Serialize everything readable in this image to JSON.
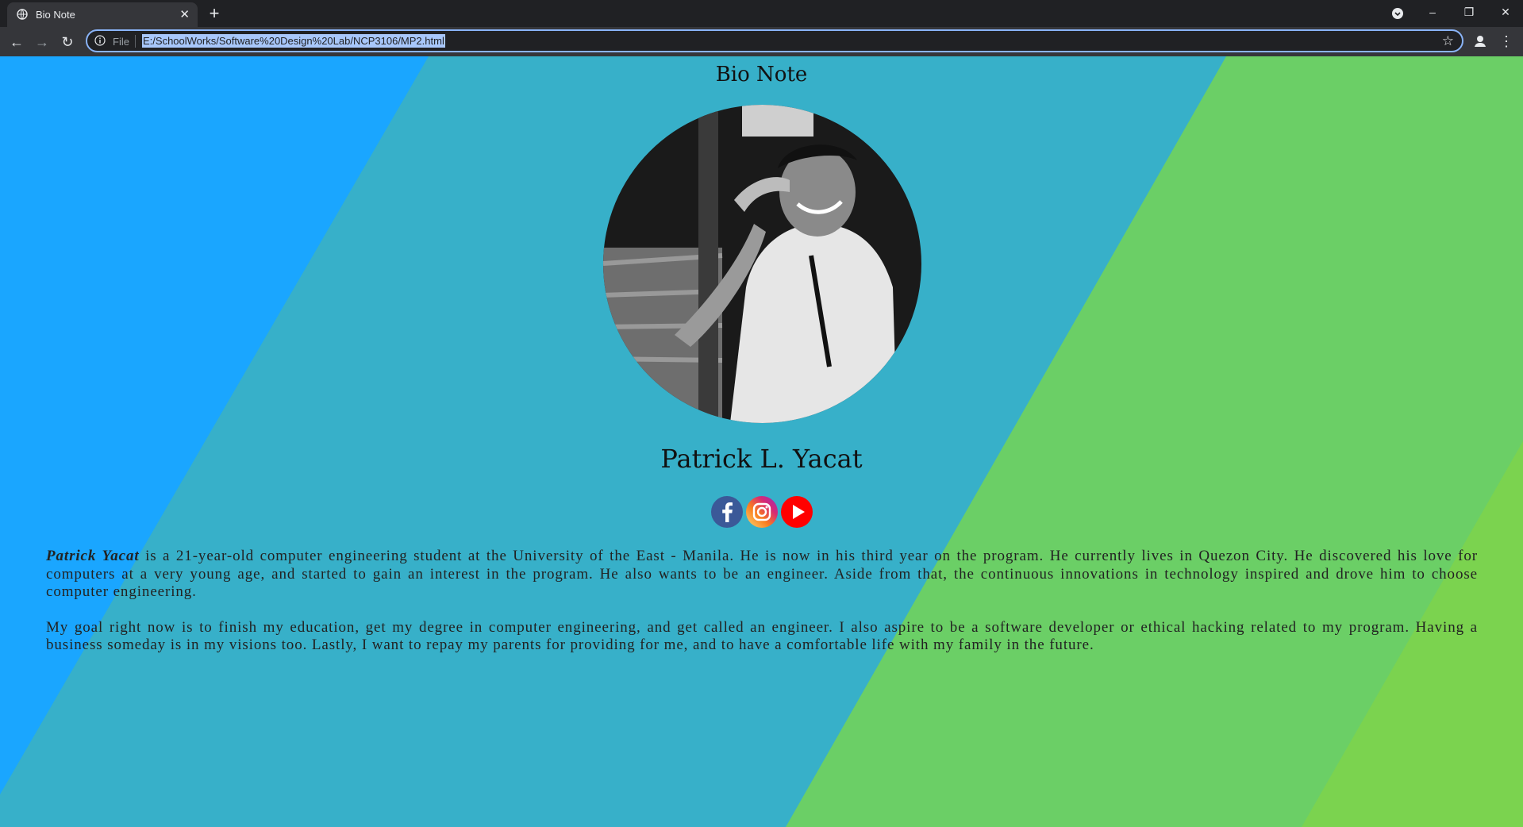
{
  "browser": {
    "tab_title": "Bio Note",
    "address_scheme": "File",
    "address_url": "E:/SchoolWorks/Software%20Design%20Lab/NCP3106/MP2.html",
    "window_controls": {
      "minimize": "–",
      "restore": "❐",
      "close": "✕"
    },
    "new_tab_label": "+"
  },
  "page": {
    "heading": "Bio Note",
    "name": "Patrick L. Yacat",
    "photo_alt": "Patrick L. Yacat",
    "socials": [
      {
        "name": "facebook-icon",
        "color": "#3b5998"
      },
      {
        "name": "instagram-icon",
        "color": "#e1306c"
      },
      {
        "name": "youtube-icon",
        "color": "#ff0000"
      }
    ],
    "bio": {
      "p1_name": "Patrick Yacat",
      "p1_text": " is a 21-year-old computer engineering student at the University of the East - Manila. He is now in his third year on the program. He currently lives in Quezon City. He discovered his love for computers at a very young age, and started to gain an interest in the program. He also wants to be an engineer. Aside from that, the continuous innovations in technology inspired and drove him to choose computer engineering.",
      "p2_text": "My goal right now is to finish my education, get my degree in computer engineering, and get called an engineer. I also aspire to be a software developer or ethical hacking related to my program. Having a business someday is in my visions too. Lastly, I want to repay my parents for providing for me, and to have a comfortable life with my family in the future."
    },
    "background_colors": {
      "left": "#1aa6ff",
      "middle": "#37b0c9",
      "right": "#6bcf66",
      "far_right": "#7bd34f"
    }
  }
}
